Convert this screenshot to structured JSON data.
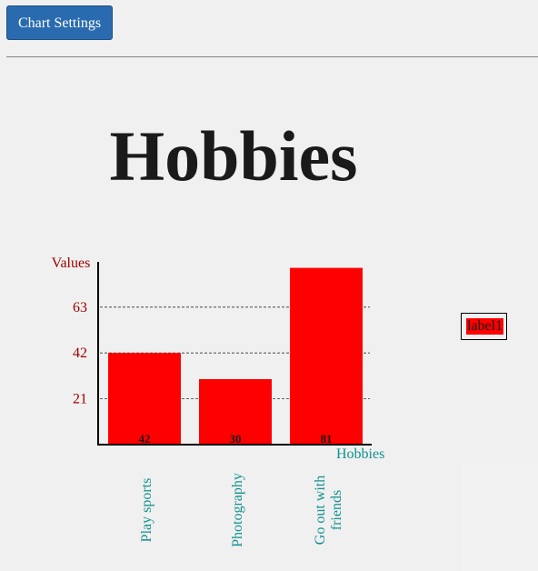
{
  "toolbar": {
    "settings_label": "Chart Settings"
  },
  "colors": {
    "bar": "#ff0000",
    "axis_text": "#a00000",
    "category_text": "#129090",
    "button_bg": "#2a6bb0"
  },
  "chart_data": {
    "type": "bar",
    "title": "Hobbies",
    "xlabel": "Hobbies",
    "ylabel": "Values",
    "categories": [
      "Play sports",
      "Photography",
      "Go out with friends"
    ],
    "category_lines": [
      [
        "Play sports"
      ],
      [
        "Photography"
      ],
      [
        "Go out with",
        "friends"
      ]
    ],
    "series": [
      {
        "name": "label1",
        "values": [
          42,
          30,
          81
        ]
      }
    ],
    "yticks": [
      21,
      42,
      63
    ],
    "ylim": [
      0,
      84
    ],
    "grid": true,
    "legend": "right"
  }
}
